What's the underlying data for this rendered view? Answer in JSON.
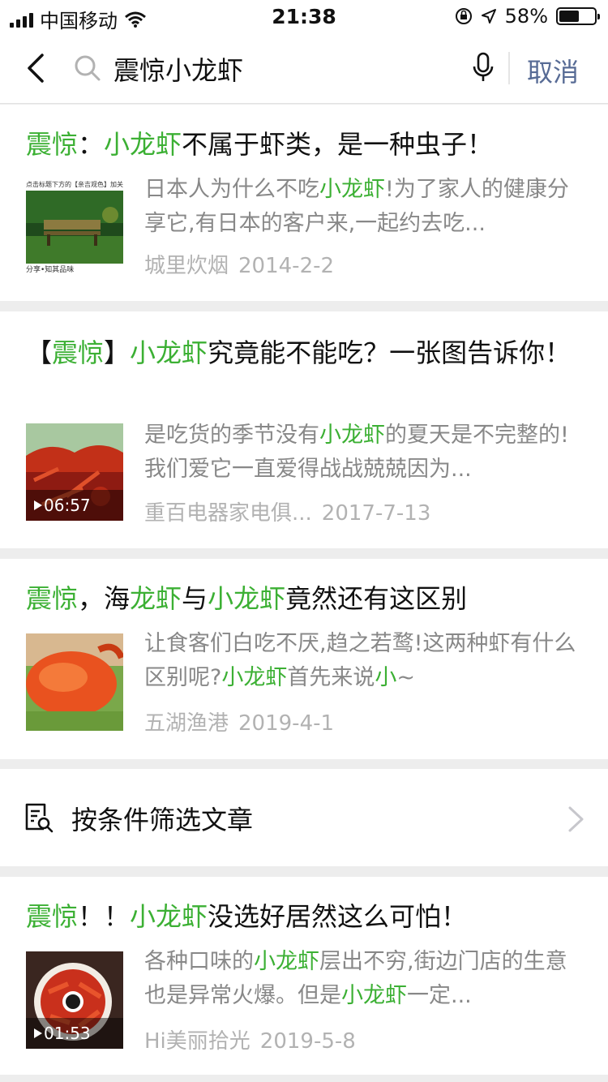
{
  "status": {
    "carrier": "中国移动",
    "time": "21:38",
    "battery_percent": "58%",
    "battery_level": 0.58
  },
  "search": {
    "query": "震惊小龙虾",
    "cancel_label": "取消"
  },
  "results": [
    {
      "title_parts": [
        {
          "t": "震惊",
          "h": true
        },
        {
          "t": "：",
          "h": false
        },
        {
          "t": "小龙虾",
          "h": true
        },
        {
          "t": "不属于虾类，是一种虫子！",
          "h": false
        }
      ],
      "desc_parts": [
        {
          "t": "日本人为什么不吃",
          "h": false
        },
        {
          "t": "小龙虾",
          "h": true
        },
        {
          "t": "!为了家人的健康分享它,有日本的客户来,一起约去吃...",
          "h": false
        }
      ],
      "source": "城里炊烟",
      "date": "2014-2-2",
      "duration": "",
      "thumb_banner": "点击标题下方的【亲吉观色】加关注",
      "thumb_footer": "分享•知其品味"
    },
    {
      "title_parts": [
        {
          "t": "【",
          "h": false
        },
        {
          "t": "震惊",
          "h": true
        },
        {
          "t": "】",
          "h": false
        },
        {
          "t": "小龙虾",
          "h": true
        },
        {
          "t": "究竟能不能吃？一张图告诉你！",
          "h": false
        }
      ],
      "desc_parts": [
        {
          "t": "是吃货的季节没有",
          "h": false
        },
        {
          "t": "小龙虾",
          "h": true
        },
        {
          "t": "的夏天是不完整的!我们爱它一直爱得战战兢兢因为...",
          "h": false
        }
      ],
      "source": "重百电器家电俱...",
      "date": "2017-7-13",
      "duration": "06:57"
    },
    {
      "title_parts": [
        {
          "t": "震惊",
          "h": true
        },
        {
          "t": "，海",
          "h": false
        },
        {
          "t": "龙虾",
          "h": true
        },
        {
          "t": "与",
          "h": false
        },
        {
          "t": "小龙虾",
          "h": true
        },
        {
          "t": "竟然还有这区别",
          "h": false
        }
      ],
      "desc_parts": [
        {
          "t": "让食客们白吃不厌,趋之若鹜!这两种虾有什么区别呢?",
          "h": false
        },
        {
          "t": "小龙虾",
          "h": true
        },
        {
          "t": "首先来说",
          "h": false
        },
        {
          "t": "小",
          "h": true
        },
        {
          "t": "~",
          "h": false
        }
      ],
      "source": "五湖渔港",
      "date": "2019-4-1",
      "duration": ""
    },
    {
      "title_parts": [
        {
          "t": "震惊",
          "h": true
        },
        {
          "t": "！！",
          "h": false
        },
        {
          "t": "小龙虾",
          "h": true
        },
        {
          "t": "没选好居然这么可怕！",
          "h": false
        }
      ],
      "desc_parts": [
        {
          "t": "各种口味的",
          "h": false
        },
        {
          "t": "小龙虾",
          "h": true
        },
        {
          "t": "层出不穷,街边门店的生意也是异常火爆。但是",
          "h": false
        },
        {
          "t": "小龙虾",
          "h": true
        },
        {
          "t": "一定...",
          "h": false
        }
      ],
      "source": "Hi美丽拾光",
      "date": "2019-5-8",
      "duration": "01:53"
    }
  ],
  "filter": {
    "label": "按条件筛选文章"
  },
  "colors": {
    "highlight": "#3cb034",
    "link": "#576b95",
    "gray_text": "#888888",
    "meta_text": "#b2b2b2"
  },
  "icons": [
    "signal-icon",
    "wifi-icon",
    "orientation-lock-icon",
    "location-arrow-icon",
    "battery-icon",
    "back-arrow-icon",
    "search-icon",
    "microphone-icon",
    "filter-document-icon",
    "chevron-right-icon",
    "play-icon"
  ]
}
